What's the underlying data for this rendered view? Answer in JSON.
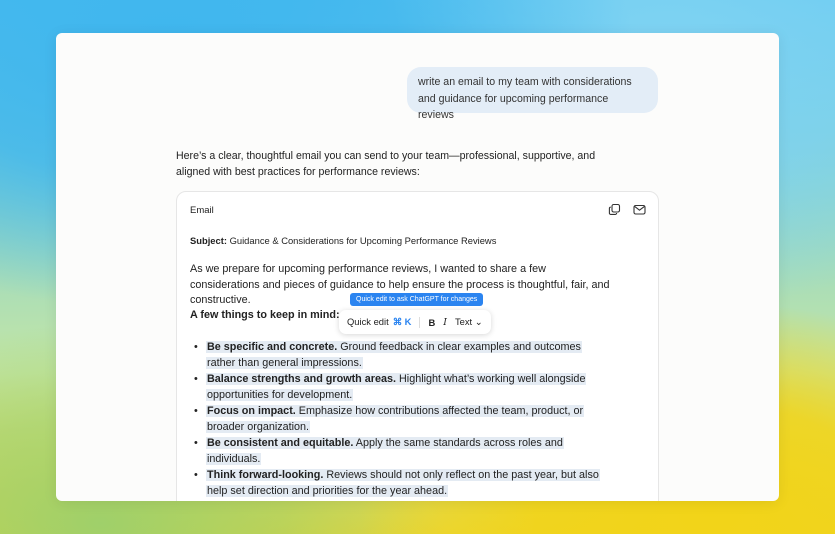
{
  "user_message": "write an email to my team with considerations and guidance for upcoming performance reviews",
  "assistant_intro": "Here’s a clear, thoughtful email you can send to your team—professional, supportive, and aligned with best practices for performance reviews:",
  "card": {
    "label": "Email",
    "icons": [
      "copy-icon",
      "mail-icon"
    ],
    "subject_label": "Subject:",
    "subject_text": "Guidance & Considerations for Upcoming Performance Reviews",
    "intro_para": "As we prepare for upcoming performance reviews, I wanted to share a few considerations and pieces of guidance to help ensure the process is thoughtful, fair, and constructive.",
    "section_heading": "A few things to keep in mind:",
    "bullets": [
      {
        "bold": "Be specific and concrete.",
        "text": " Ground feedback in clear examples and outcomes rather than general impressions."
      },
      {
        "bold": "Balance strengths and growth areas.",
        "text": " Highlight what’s working well alongside opportunities for development."
      },
      {
        "bold": "Focus on impact.",
        "text": " Emphasize how contributions affected the team, product, or broader organization."
      },
      {
        "bold": "Be consistent and equitable.",
        "text": " Apply the same standards across roles and individuals."
      },
      {
        "bold": "Think forward-looking.",
        "text": " Reviews should not only reflect on the past year, but also help set direction and priorities for the year ahead."
      }
    ]
  },
  "tooltip": "Quick edit to ask ChatGPT for changes",
  "toolbar": {
    "quick_edit": "Quick edit",
    "shortcut": "⌘ K",
    "bold": "B",
    "italic": "I",
    "text_menu": "Text ⌄"
  },
  "colors": {
    "accent": "#2b84f0",
    "user_bubble": "#e3edf7",
    "selection": "#e4ebf3"
  }
}
